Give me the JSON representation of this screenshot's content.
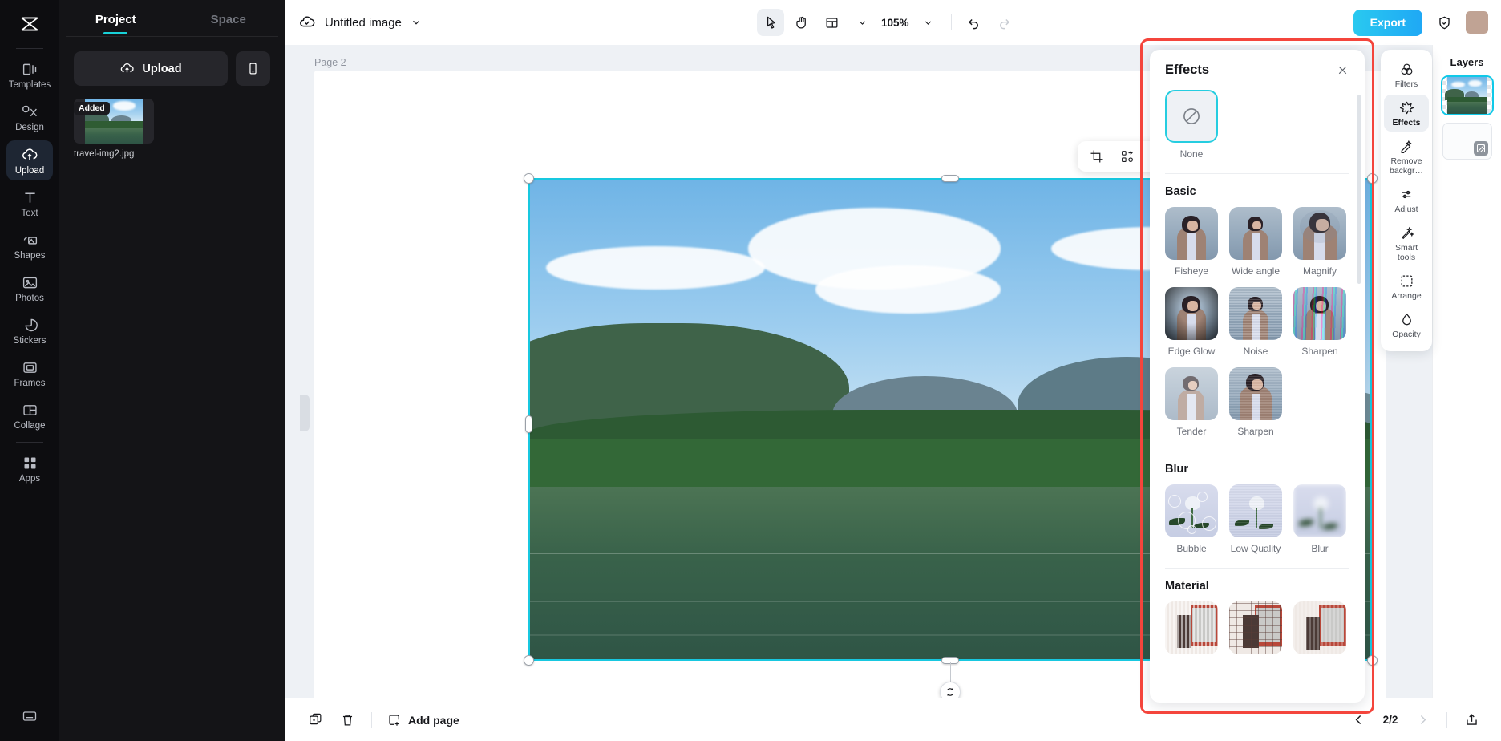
{
  "app": {
    "left_rail": {
      "logo_icon": "capcut-logo-icon",
      "items": [
        {
          "label": "Templates",
          "icon": "templates-icon",
          "active": false
        },
        {
          "label": "Design",
          "icon": "design-icon",
          "active": false
        },
        {
          "label": "Upload",
          "icon": "upload-cloud-icon",
          "active": true
        },
        {
          "label": "Text",
          "icon": "text-icon",
          "active": false
        },
        {
          "label": "Shapes",
          "icon": "shapes-icon",
          "active": false
        },
        {
          "label": "Photos",
          "icon": "photos-icon",
          "active": false
        },
        {
          "label": "Stickers",
          "icon": "stickers-icon",
          "active": false
        },
        {
          "label": "Frames",
          "icon": "frames-icon",
          "active": false
        },
        {
          "label": "Collage",
          "icon": "collage-icon",
          "active": false
        },
        {
          "label": "Apps",
          "icon": "apps-icon",
          "active": false
        }
      ],
      "bottom_icon": "help-icon"
    },
    "project_panel": {
      "tabs": [
        {
          "label": "Project",
          "active": true
        },
        {
          "label": "Space",
          "active": false
        }
      ],
      "upload_button": "Upload",
      "phone_upload_icon": "phone-icon",
      "assets": [
        {
          "name": "travel-img2.jpg",
          "badge": "Added"
        }
      ]
    },
    "topbar": {
      "cloud_icon": "cloud-check-icon",
      "doc_title": "Untitled image",
      "title_caret_icon": "chevron-down-icon",
      "tools": [
        {
          "name": "select-tool",
          "icon": "cursor-icon",
          "active": true
        },
        {
          "name": "hand-tool",
          "icon": "hand-icon",
          "active": false
        },
        {
          "name": "layout-tool",
          "icon": "layout-icon",
          "active": false
        }
      ],
      "layout_caret_icon": "chevron-down-icon",
      "zoom_level": "105%",
      "zoom_caret_icon": "chevron-down-icon",
      "undo_icon": "undo-icon",
      "redo_icon": "redo-icon",
      "redo_disabled": true,
      "export_label": "Export",
      "shield_icon": "shield-check-icon",
      "avatar": "user-avatar"
    },
    "canvas": {
      "page_label": "Page 2",
      "float_tools": [
        {
          "name": "crop-button",
          "icon": "crop-icon"
        },
        {
          "name": "replace-button",
          "icon": "swap-icon"
        },
        {
          "name": "duplicate-button",
          "icon": "duplicate-icon"
        },
        {
          "name": "more-button",
          "icon": "more-horizontal-icon"
        }
      ],
      "rotate_icon": "rotate-icon",
      "selection_color": "#18c8e0"
    },
    "effects_panel": {
      "title": "Effects",
      "close_icon": "close-icon",
      "highlight_color": "#f4453c",
      "selected": "None",
      "none_tile": {
        "label": "None",
        "icon": "no-effect-icon",
        "selected": true
      },
      "sections": [
        {
          "title": "Basic",
          "items": [
            {
              "label": "Fisheye",
              "style": "fisheye"
            },
            {
              "label": "Wide angle",
              "style": "wide"
            },
            {
              "label": "Magnify",
              "style": "magnify"
            },
            {
              "label": "Edge Glow",
              "style": "glow"
            },
            {
              "label": "Noise",
              "style": "noise"
            },
            {
              "label": "Sharpen",
              "style": "sharpen"
            },
            {
              "label": "Tender",
              "style": "tender"
            },
            {
              "label": "Sharpen",
              "style": "sharpen2"
            }
          ]
        },
        {
          "title": "Blur",
          "items": [
            {
              "label": "Bubble",
              "style": "bubble"
            },
            {
              "label": "Low Quality",
              "style": "lowq"
            },
            {
              "label": "Blur",
              "style": "blur"
            }
          ]
        },
        {
          "title": "Material",
          "items": [
            {
              "label": "",
              "style": "mat1"
            },
            {
              "label": "",
              "style": "mat2"
            },
            {
              "label": "",
              "style": "mat3"
            }
          ]
        }
      ]
    },
    "right_rail": {
      "items": [
        {
          "label": "Filters",
          "icon": "filters-icon",
          "active": false
        },
        {
          "label": "Effects",
          "icon": "effects-icon",
          "active": true
        },
        {
          "label": "Remove backgr…",
          "icon": "magic-eraser-icon",
          "active": false
        },
        {
          "label": "Adjust",
          "icon": "sliders-icon",
          "active": false
        },
        {
          "label": "Smart tools",
          "icon": "wand-icon",
          "active": false
        },
        {
          "label": "Arrange",
          "icon": "arrange-icon",
          "active": false
        },
        {
          "label": "Opacity",
          "icon": "droplet-icon",
          "active": false
        }
      ]
    },
    "layers_panel": {
      "title": "Layers",
      "layers": [
        {
          "name": "image-layer",
          "selected": true,
          "empty": false
        },
        {
          "name": "blank-layer",
          "selected": false,
          "empty": true,
          "chip_icon": "mask-icon"
        }
      ]
    },
    "bottombar": {
      "duplicate_page_icon": "duplicate-page-icon",
      "delete_page_icon": "trash-icon",
      "add_page_label": "Add page",
      "add_page_icon": "add-page-icon",
      "prev_icon": "chevron-left-icon",
      "page_indicator": "2/2",
      "next_icon": "chevron-right-icon",
      "next_disabled": true,
      "share_icon": "share-icon"
    }
  }
}
